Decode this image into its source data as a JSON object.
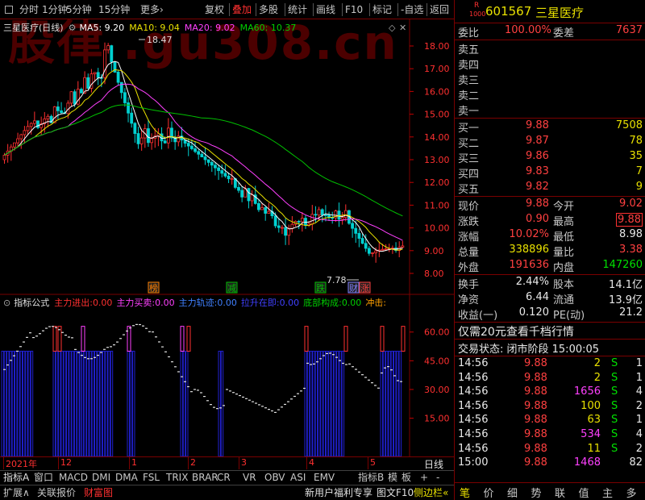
{
  "toolbar": {
    "left": [
      "分时",
      "1分钟",
      "5分钟",
      "15分钟",
      "更多›"
    ],
    "right": [
      "复权",
      "叠加",
      "多股",
      "统计",
      "画线",
      "F10",
      "标记",
      "-自选",
      "返回"
    ]
  },
  "watermark": "股律 .gu308.cn",
  "chart": {
    "stock_title": "三星医疗(日线)",
    "ma": [
      {
        "label": "MA5: 9.20",
        "color": "#ffffff"
      },
      {
        "label": "MA10: 9.04",
        "color": "#e8e000"
      },
      {
        "label": "MA20: 9.02",
        "color": "#ff40ff"
      },
      {
        "label": "MA60: 10.37",
        "color": "#00d000"
      }
    ],
    "price_ticks": [
      "18.00",
      "17.00",
      "16.00",
      "15.00",
      "14.00",
      "13.00",
      "12.00",
      "11.00",
      "10.00",
      "9.00",
      "8.00"
    ],
    "high_label": "18.47",
    "low_label": "7.78",
    "markers": [
      {
        "text": "榜",
        "color": "#ff8000"
      },
      {
        "text": "减",
        "color": "#00c000"
      },
      {
        "text": "跌",
        "color": "#00c000"
      },
      {
        "text": "财",
        "color": "#8080ff"
      },
      {
        "text": "涨",
        "color": "#ff4040"
      }
    ]
  },
  "indicator": {
    "label": "指标公式",
    "items": [
      {
        "name": "主力进出:",
        "value": "0.00",
        "color": "#ff3030"
      },
      {
        "name": "主力买卖:",
        "value": "0.00",
        "color": "#ff40ff"
      },
      {
        "name": "主力轨迹:",
        "value": "0.00",
        "color": "#4080ff"
      },
      {
        "name": "拉升在即:",
        "value": "0.00",
        "color": "#4040ff"
      },
      {
        "name": "底部构成:",
        "value": "0.00",
        "color": "#00d000"
      },
      {
        "name": "冲击:",
        "value": "",
        "color": "#ffa000"
      }
    ],
    "ticks": [
      "60.00",
      "45.00",
      "30.00",
      "15.00"
    ]
  },
  "dates": [
    "2021年",
    "12",
    "1",
    "2",
    "3",
    "4",
    "5"
  ],
  "period_label": "日线",
  "tabs": [
    "指标A",
    "窗口",
    "MACD",
    "DMI",
    "DMA",
    "FSL",
    "TRIX",
    "BRAR",
    "CR",
    "VR",
    "OBV",
    "ASI",
    "EMV",
    "指标B",
    "模",
    "板",
    "+",
    "-"
  ],
  "bottom": {
    "left": [
      "扩展∧",
      "关联报价",
      "财富图"
    ],
    "right": [
      "新用户福利专享",
      "图文F10",
      "侧边栏«"
    ]
  },
  "quote": {
    "badge_r": "R",
    "badge_num": "1000",
    "code": "601567",
    "name": "三星医疗",
    "weibi_label": "委比",
    "weibi": "100.00%",
    "weicha_label": "委差",
    "weicha": "7637",
    "sell": [
      {
        "label": "卖五"
      },
      {
        "label": "卖四"
      },
      {
        "label": "卖三"
      },
      {
        "label": "卖二"
      },
      {
        "label": "卖一"
      }
    ],
    "buy": [
      {
        "label": "买一",
        "price": "9.88",
        "vol": "7508"
      },
      {
        "label": "买二",
        "price": "9.87",
        "vol": "78"
      },
      {
        "label": "买三",
        "price": "9.86",
        "vol": "35"
      },
      {
        "label": "买四",
        "price": "9.83",
        "vol": "7"
      },
      {
        "label": "买五",
        "price": "9.82",
        "vol": "9"
      }
    ],
    "stats": [
      {
        "l1": "现价",
        "v1": "9.88",
        "c1": "red",
        "l2": "今开",
        "v2": "9.02",
        "c2": "red"
      },
      {
        "l1": "涨跌",
        "v1": "0.90",
        "c1": "red",
        "l2": "最高",
        "v2": "9.88",
        "c2": "red"
      },
      {
        "l1": "涨幅",
        "v1": "10.02%",
        "c1": "red",
        "l2": "最低",
        "v2": "8.98",
        "c2": "white"
      },
      {
        "l1": "总量",
        "v1": "338896",
        "c1": "yellow",
        "l2": "量比",
        "v2": "3.38",
        "c2": "red"
      },
      {
        "l1": "外盘",
        "v1": "191636",
        "c1": "red",
        "l2": "内盘",
        "v2": "147260",
        "c2": "green"
      }
    ],
    "stats2": [
      {
        "l1": "换手",
        "v1": "2.44%",
        "l2": "股本",
        "v2": "14.1亿"
      },
      {
        "l1": "净资",
        "v1": "6.44",
        "l2": "流通",
        "v2": "13.9亿"
      },
      {
        "l1": "收益(一)",
        "v1": "0.120",
        "l2": "PE(动)",
        "v2": "21.2"
      }
    ],
    "promo": "仅需20元查看千档行情",
    "status": "交易状态: 闭市阶段 15:00:05",
    "ticks": [
      {
        "t": "14:56",
        "p": "9.88",
        "v": "2",
        "vc": "yellow",
        "s": "S",
        "n": "1"
      },
      {
        "t": "14:56",
        "p": "9.88",
        "v": "2",
        "vc": "yellow",
        "s": "S",
        "n": "1"
      },
      {
        "t": "14:56",
        "p": "9.88",
        "v": "1656",
        "vc": "magenta",
        "s": "S",
        "n": "4"
      },
      {
        "t": "14:56",
        "p": "9.88",
        "v": "100",
        "vc": "yellow",
        "s": "S",
        "n": "2"
      },
      {
        "t": "14:56",
        "p": "9.88",
        "v": "63",
        "vc": "yellow",
        "s": "S",
        "n": "1"
      },
      {
        "t": "14:56",
        "p": "9.88",
        "v": "534",
        "vc": "magenta",
        "s": "S",
        "n": "4"
      },
      {
        "t": "14:56",
        "p": "9.88",
        "v": "11",
        "vc": "yellow",
        "s": "S",
        "n": "2"
      },
      {
        "t": "15:00",
        "p": "9.88",
        "v": "1468",
        "vc": "magenta",
        "s": "",
        "n": "82"
      }
    ],
    "bottom_tabs": [
      "笔",
      "价",
      "细",
      "势",
      "联",
      "值",
      "主",
      "多"
    ]
  }
}
